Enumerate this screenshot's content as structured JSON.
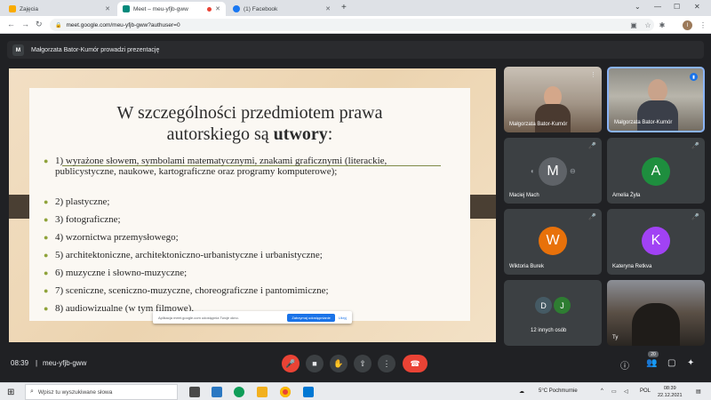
{
  "browser": {
    "tabs": [
      {
        "label": "Zajęcia"
      },
      {
        "label": "Meet – meu-yfjb-gww"
      },
      {
        "label": "(1) Facebook"
      }
    ],
    "new_tab": "+",
    "url": "meet.google.com/meu-yfjb-gww?authuser=0",
    "profile_initial": "I"
  },
  "meet": {
    "presenter_initial": "M",
    "presenter_banner": "Małgorzata Bator-Kumór prowadzi prezentację",
    "meeting_time": "08:39",
    "meeting_code": "meu-yfjb-gww",
    "participants_badge": "20"
  },
  "slide": {
    "title_line1": "W szczególności przedmiotem prawa",
    "title_line2_pre": "autorskiego są ",
    "title_line2_bold": "utwory",
    "title_line2_post": ":",
    "bullets": [
      "1) wyrażone słowem, symbolami matematycznymi, znakami graficznymi (literackie, publicystyczne, naukowe, kartograficzne oraz programy komputerowe);",
      "2) plastyczne;",
      "3) fotograficzne;",
      "4) wzornictwa przemysłowego;",
      "5) architektoniczne, architektoniczno-urbanistyczne i urbanistyczne;",
      "6) muzyczne i słowno-muzyczne;",
      "7) sceniczne, sceniczno-muzyczne, choreograficzne i pantomimiczne;",
      "8) audiowizualne (w tym filmowe)."
    ],
    "popup_message": "Aplikacja meet.google.com udostępnia Twoje okno.",
    "popup_stop": "Zatrzymaj udostępnianie",
    "popup_hide": "Ukryj"
  },
  "participants": [
    {
      "name": "Małgorzata Bator-Kumór",
      "type": "video"
    },
    {
      "name": "Małgorzata Bator-Kumór",
      "type": "video"
    },
    {
      "name": "Maciej Mach",
      "initial": "M",
      "color": "#5f6368"
    },
    {
      "name": "Amelia Żyła",
      "initial": "A",
      "color": "#1e8e3e"
    },
    {
      "name": "Wiktoria Burek",
      "initial": "W",
      "color": "#e8710a"
    },
    {
      "name": "Kateryna Retkva",
      "initial": "K",
      "color": "#a142f4"
    },
    {
      "name": "12 innych osób",
      "initial_1": "D",
      "initial_2": "J",
      "color_1": "#455a64",
      "color_2": "#2e7d32"
    },
    {
      "name": "Ty",
      "type": "video"
    }
  ],
  "taskbar": {
    "search_placeholder": "Wpisz tu wyszukiwane słowa",
    "weather": "5°C  Pochmurnie",
    "language": "POL",
    "clock_time": "08:39",
    "clock_date": "22.12.2021"
  },
  "colors": {
    "meet_bg": "#202124",
    "end_call": "#ea4335",
    "accent": "#1a73e8",
    "bullet": "#8fa33a"
  }
}
